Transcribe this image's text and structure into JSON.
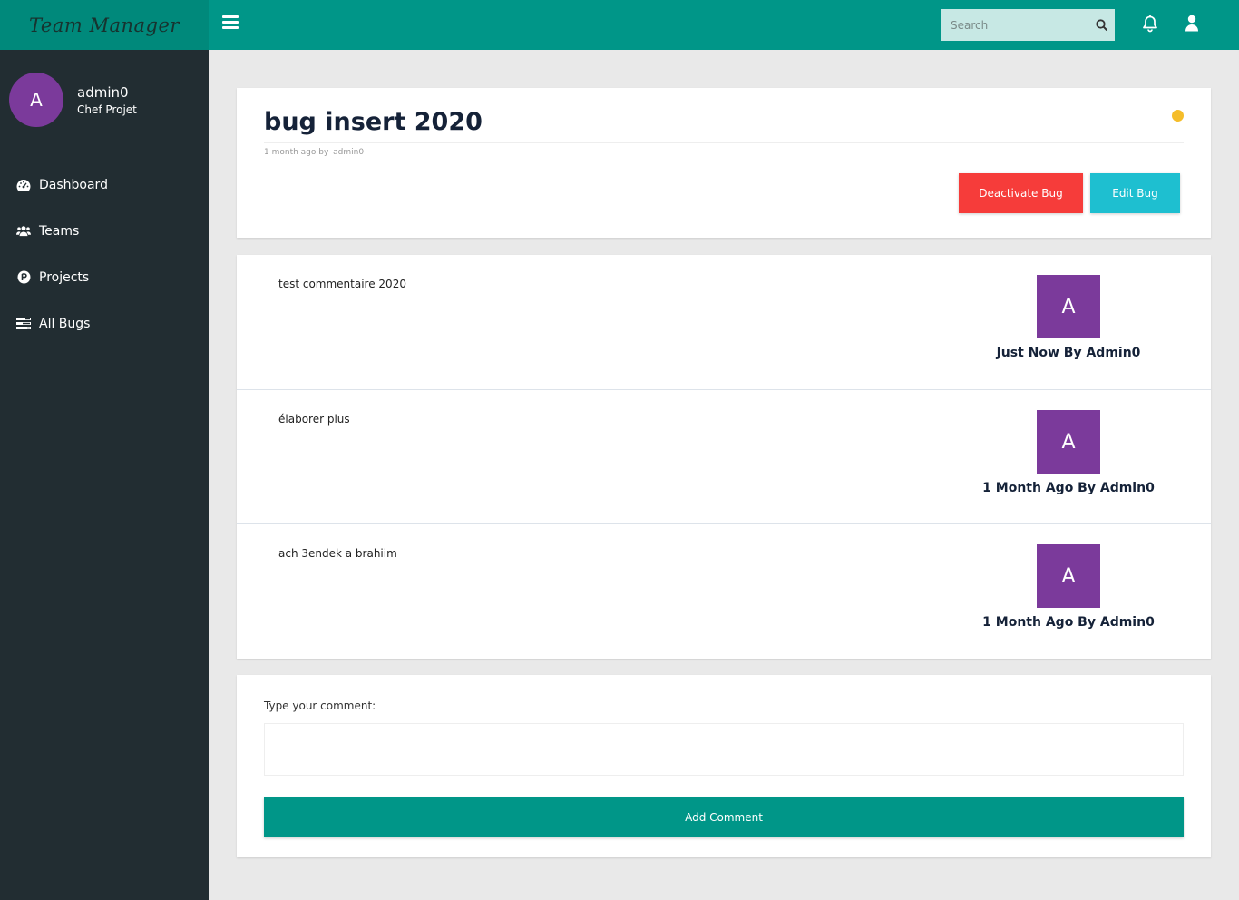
{
  "app": {
    "brand": "Team Manager",
    "accent_color": "#009688",
    "sidebar_color": "#222d32"
  },
  "user": {
    "initial": "A",
    "name": "admin0",
    "role": "Chef Projet",
    "avatar_color": "#7b3a9b"
  },
  "sidebar": {
    "items": [
      {
        "label": "Dashboard",
        "icon": "dashboard-icon"
      },
      {
        "label": "Teams",
        "icon": "users-icon"
      },
      {
        "label": "Projects",
        "icon": "product-hunt-icon"
      },
      {
        "label": "All Bugs",
        "icon": "tasks-icon"
      }
    ]
  },
  "topbar": {
    "menu_icon": "hamburger-icon",
    "search_placeholder": "Search",
    "search_icon": "search-icon",
    "bell_icon": "bell-icon",
    "user_icon": "user-icon"
  },
  "bug": {
    "title": "bug insert 2020",
    "meta_time": "1 month ago by",
    "meta_author": "admin0",
    "status_color": "#f5bd2a",
    "deactivate_label": "Deactivate Bug",
    "edit_label": "Edit Bug"
  },
  "comments": [
    {
      "text": "test commentaire 2020",
      "avatar": "A",
      "author_line": "Just Now By Admin0"
    },
    {
      "text": "élaborer plus",
      "avatar": "A",
      "author_line": "1 Month Ago By Admin0"
    },
    {
      "text": "ach 3endek a brahiim",
      "avatar": "A",
      "author_line": "1 Month Ago By Admin0"
    }
  ],
  "form": {
    "label": "Type your comment:",
    "value": "",
    "submit_label": "Add Comment"
  }
}
